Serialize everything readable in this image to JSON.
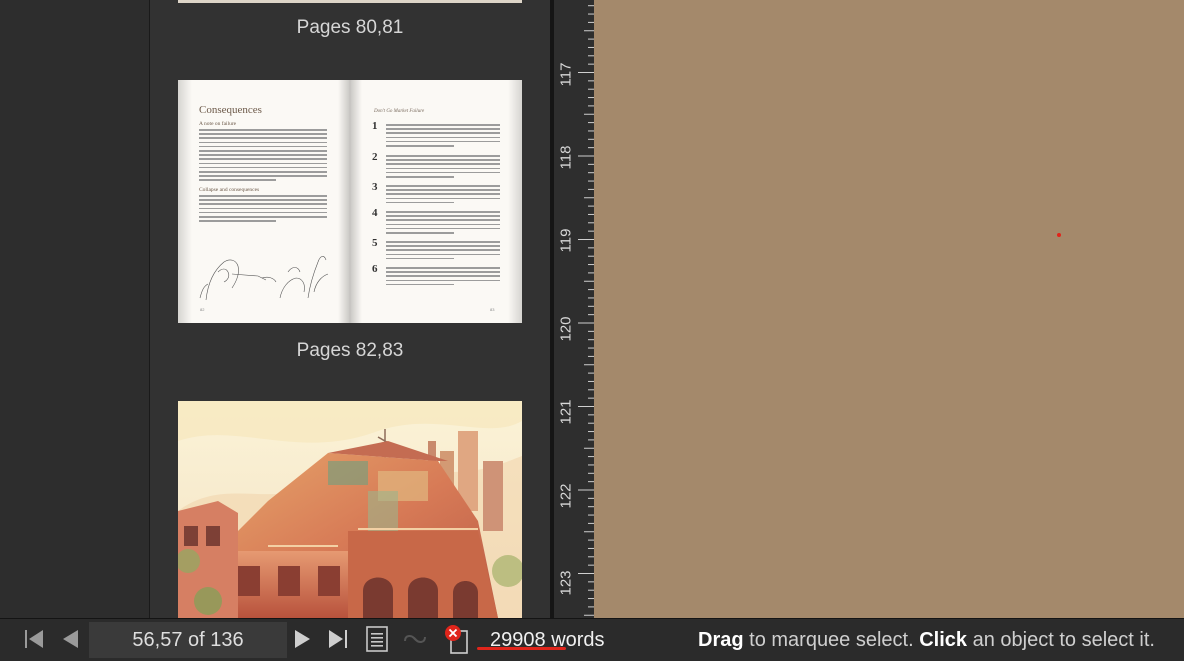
{
  "thumbnails": {
    "top_label": "Pages 80,81",
    "middle_label": "Pages 82,83",
    "spread": {
      "left_title": "Consequences",
      "left_subheads": [
        "A note on failure",
        "Collapse and consequences"
      ],
      "right_header": "Don't Go Market Failure",
      "numbers": [
        "1",
        "2",
        "3",
        "4",
        "5",
        "6"
      ]
    }
  },
  "ruler": {
    "labels": [
      "117",
      "118",
      "119",
      "120",
      "121",
      "122",
      "123"
    ]
  },
  "bottom_bar": {
    "page_indicator": "56,57 of 136",
    "word_count": "29908",
    "words_suffix": "words",
    "status_drag": "Drag",
    "status_mid": " to marquee select. ",
    "status_click": "Click",
    "status_end": " an object to select it."
  },
  "colors": {
    "canvas": "#a4896b",
    "accent_red": "#e0251b"
  },
  "icons": [
    "first-page-icon",
    "previous-page-icon",
    "next-page-icon",
    "last-page-icon",
    "page-view-icon",
    "link-disabled-icon",
    "error-icon"
  ]
}
